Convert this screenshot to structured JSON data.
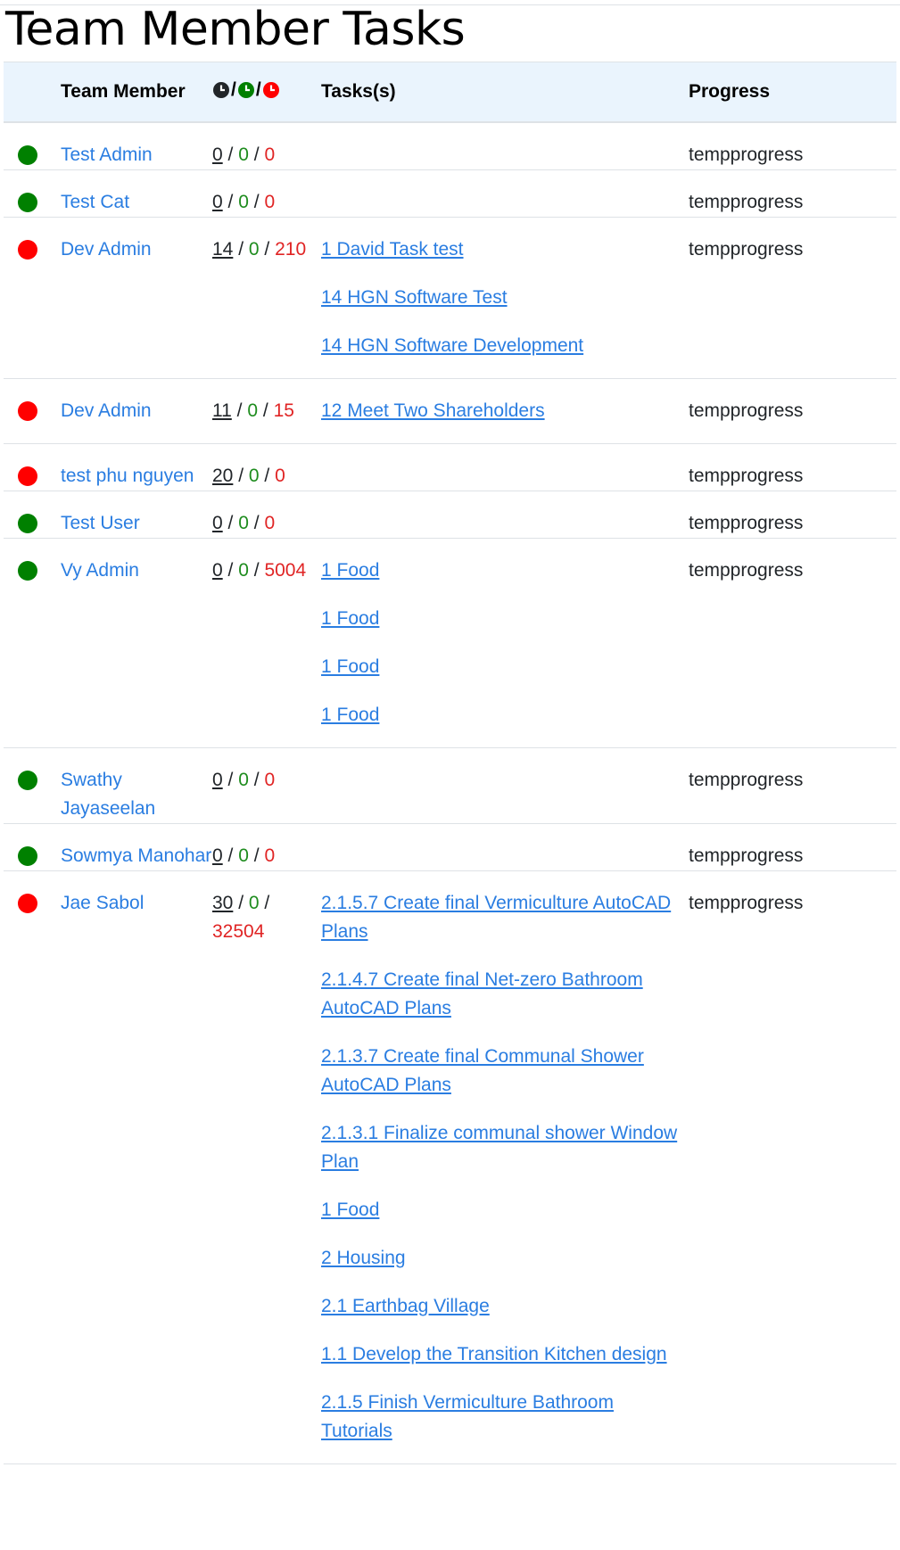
{
  "page_title": "Team Member Tasks",
  "headers": {
    "member": "Team Member",
    "tasks": "Tasks(s)",
    "progress": "Progress",
    "separator": "/"
  },
  "colors": {
    "green": "#008000",
    "red": "#ff0000",
    "link": "#2a7de1"
  },
  "rows": [
    {
      "status": "green",
      "name": "Test Admin",
      "total": "0",
      "done": "0",
      "remaining": "0",
      "tasks": [],
      "progress": "tempprogress"
    },
    {
      "status": "green",
      "name": "Test Cat",
      "total": "0",
      "done": "0",
      "remaining": "0",
      "tasks": [],
      "progress": "tempprogress"
    },
    {
      "status": "red",
      "name": "Dev Admin",
      "total": "14",
      "done": "0",
      "remaining": "210",
      "tasks": [
        "1 David Task test",
        "14 HGN Software Test",
        "14 HGN Software Development"
      ],
      "progress": "tempprogress"
    },
    {
      "status": "red",
      "name": "Dev Admin",
      "total": "11",
      "done": "0",
      "remaining": "15",
      "tasks": [
        "12 Meet Two Shareholders"
      ],
      "progress": "tempprogress"
    },
    {
      "status": "red",
      "name": "test phu nguyen",
      "total": "20",
      "done": "0",
      "remaining": "0",
      "tasks": [],
      "progress": "tempprogress"
    },
    {
      "status": "green",
      "name": "Test User",
      "total": "0",
      "done": "0",
      "remaining": "0",
      "tasks": [],
      "progress": "tempprogress"
    },
    {
      "status": "green",
      "name": "Vy Admin",
      "total": "0",
      "done": "0",
      "remaining": "5004",
      "tasks": [
        "1 Food",
        "1 Food",
        "1 Food",
        "1 Food"
      ],
      "progress": "tempprogress"
    },
    {
      "status": "green",
      "name": "Swathy Jayaseelan",
      "total": "0",
      "done": "0",
      "remaining": "0",
      "tasks": [],
      "progress": "tempprogress"
    },
    {
      "status": "green",
      "name": "Sowmya Manohar",
      "total": "0",
      "done": "0",
      "remaining": "0",
      "tasks": [],
      "progress": "tempprogress"
    },
    {
      "status": "red",
      "name": "Jae Sabol",
      "total": "30",
      "done": "0",
      "remaining": "32504",
      "tasks": [
        "2.1.5.7 Create final Vermiculture AutoCAD Plans",
        "2.1.4.7 Create final Net-zero Bathroom AutoCAD Plans",
        "2.1.3.7 Create final Communal Shower AutoCAD Plans",
        "2.1.3.1 Finalize communal shower Window Plan",
        "1 Food",
        "2 Housing",
        "2.1 Earthbag Village",
        "1.1 Develop the Transition Kitchen design",
        "2.1.5 Finish Vermiculture Bathroom Tutorials"
      ],
      "progress": "tempprogress"
    }
  ]
}
